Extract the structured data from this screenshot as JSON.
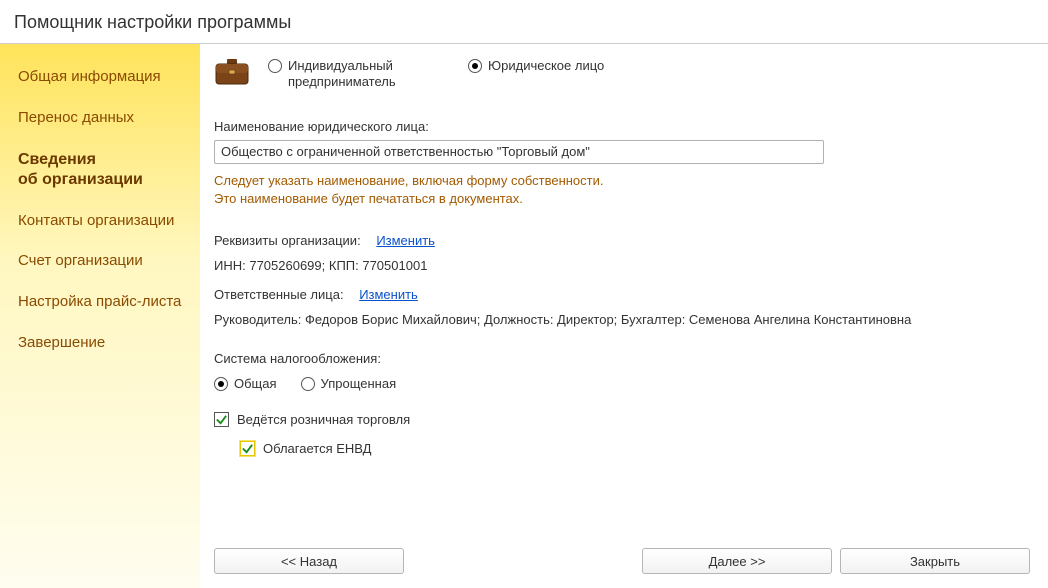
{
  "window": {
    "title": "Помощник настройки программы"
  },
  "sidebar": {
    "items": [
      {
        "label": "Общая информация"
      },
      {
        "label": "Перенос данных"
      },
      {
        "label": "Сведения об организации"
      },
      {
        "label": "Контакты организации"
      },
      {
        "label": "Счет организации"
      },
      {
        "label": "Настройка прайс-листа"
      },
      {
        "label": "Завершение"
      }
    ],
    "activeIndex": 2
  },
  "orgType": {
    "individual": "Индивидуальный предприниматель",
    "legal": "Юридическое лицо",
    "selected": "legal"
  },
  "name": {
    "label": "Наименование юридического лица:",
    "value": "Общество с ограниченной ответственностью \"Торговый дом\"",
    "hint1": "Следует указать наименование, включая форму собственности.",
    "hint2": "Это наименование будет печататься в документах."
  },
  "requisites": {
    "label": "Реквизиты организации:",
    "changeLink": "Изменить",
    "innkppLine": "ИНН: 7705260699; КПП: 770501001"
  },
  "responsibles": {
    "label": "Ответственные лица:",
    "changeLink": "Изменить",
    "summary": "Руководитель: Федоров Борис Михайлович; Должность: Директор; Бухгалтер: Семенова Ангелина Константиновна"
  },
  "tax": {
    "label": "Система налогообложения:",
    "general": "Общая",
    "simplified": "Упрощенная",
    "selected": "general",
    "retailLabel": "Ведётся розничная торговля",
    "retailChecked": true,
    "envdLabel": "Облагается ЕНВД",
    "envdChecked": true
  },
  "footer": {
    "back": "<< Назад",
    "next": "Далее >>",
    "close": "Закрыть"
  }
}
